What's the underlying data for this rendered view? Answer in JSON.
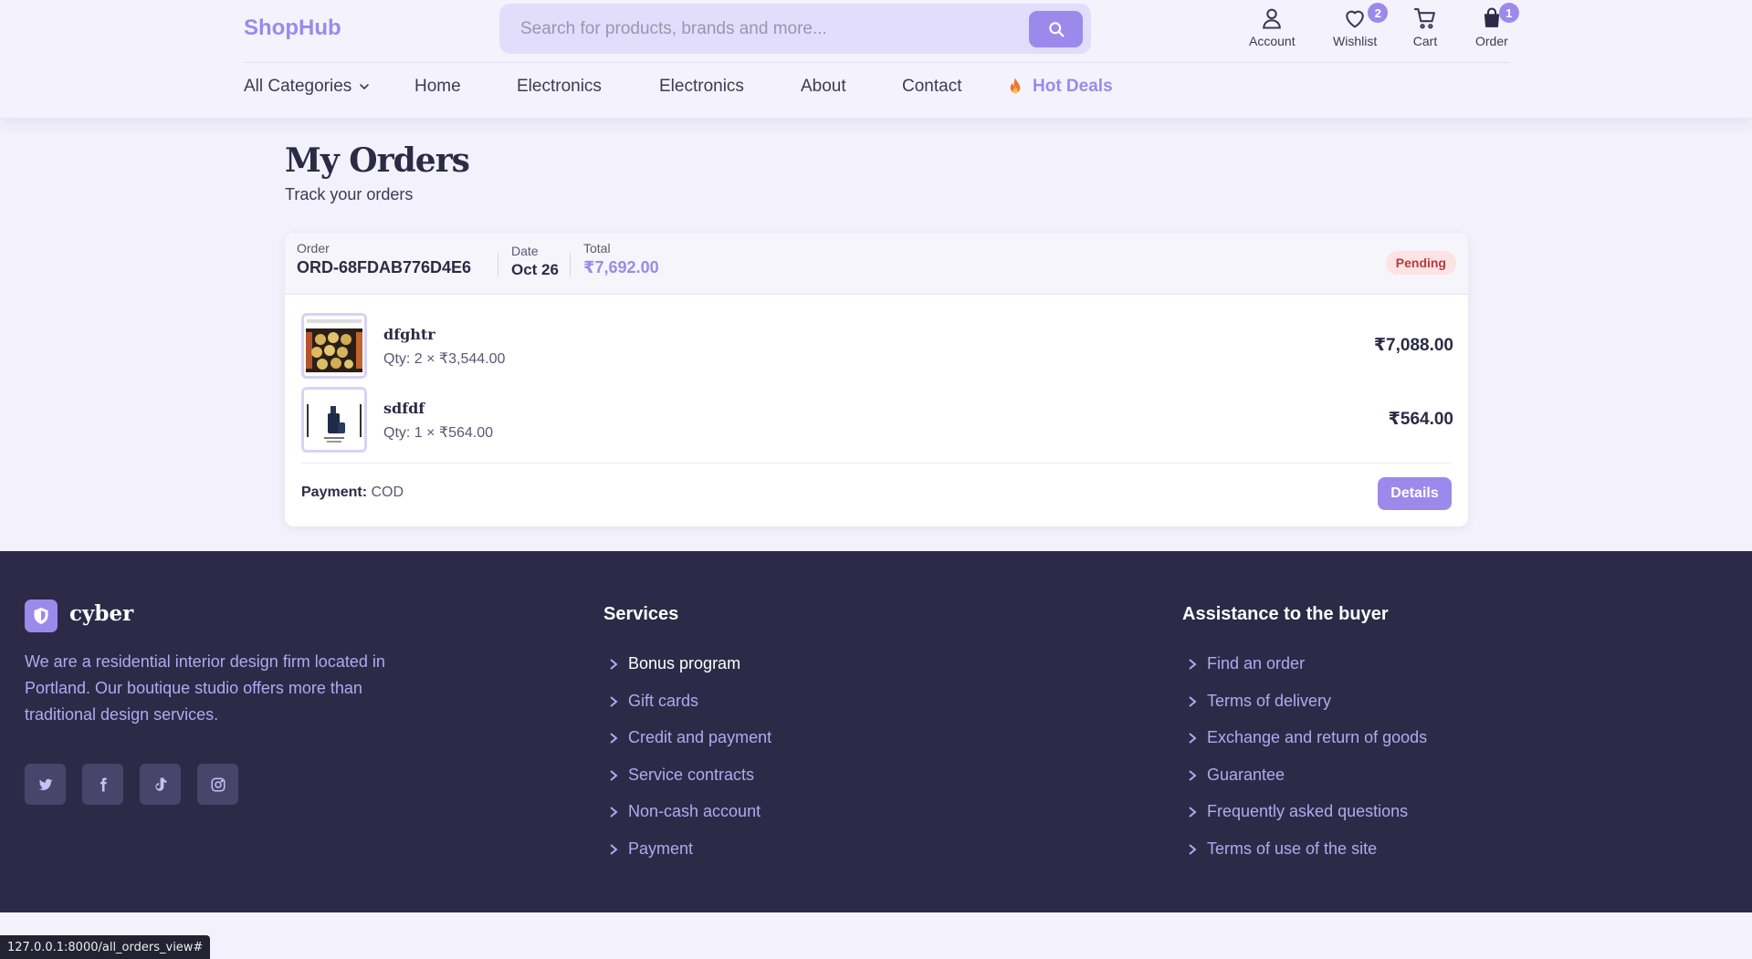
{
  "header": {
    "logo": "ShopHub",
    "search_placeholder": "Search for products, brands and more...",
    "icons": [
      {
        "label": "Account",
        "icon": "user-icon",
        "badge": ""
      },
      {
        "label": "Wishlist",
        "icon": "heart-icon",
        "badge": "2"
      },
      {
        "label": "Cart",
        "icon": "cart-icon",
        "badge": ""
      },
      {
        "label": "Order",
        "icon": "bag-icon",
        "badge": "1"
      }
    ],
    "menu": {
      "categories": "All Categories",
      "items": [
        "Home",
        "Electronics",
        "Electronics",
        "About",
        "Contact"
      ],
      "hot_deals": "Hot Deals"
    }
  },
  "main": {
    "title": "My Orders",
    "subtitle": "Track your orders",
    "order": {
      "order_label": "Order",
      "order_id": "ORD-68FDAB776D4E6",
      "date_label": "Date",
      "date": "Oct 26",
      "total_label": "Total",
      "total": "₹7,692.00",
      "status": "Pending",
      "items": [
        {
          "name": "dfghtr",
          "qty": "Qty: 2 × ₹3,544.00",
          "line_total": "₹7,088.00"
        },
        {
          "name": "sdfdf",
          "qty": "Qty: 1 × ₹564.00",
          "line_total": "₹564.00"
        }
      ],
      "payment_label": "Payment:",
      "payment_method": "COD",
      "details_button": "Details"
    }
  },
  "footer": {
    "brand": "cyber",
    "description": "We are a residential interior design firm located in Portland. Our boutique studio offers more than traditional design services.",
    "socials": [
      "twitter-icon",
      "facebook-icon",
      "tiktok-icon",
      "instagram-icon"
    ],
    "services": {
      "title": "Services",
      "links": [
        "Bonus program",
        "Gift cards",
        "Credit and payment",
        "Service contracts",
        "Non-cash account",
        "Payment"
      ]
    },
    "assistance": {
      "title": "Assistance to the buyer",
      "links": [
        "Find an order",
        "Terms of delivery",
        "Exchange and return of goods",
        "Guarantee",
        "Frequently asked questions",
        "Terms of use of the site"
      ]
    }
  },
  "status_bar": {
    "url": "127.0.0.1:8000/all_orders_view#"
  },
  "colors": {
    "accent": "#9b8aeb",
    "footer_bg": "#2d2a47",
    "page_bg": "#f3f1fb",
    "pending_bg": "#fde3e3",
    "pending_text": "#b13d3d"
  }
}
